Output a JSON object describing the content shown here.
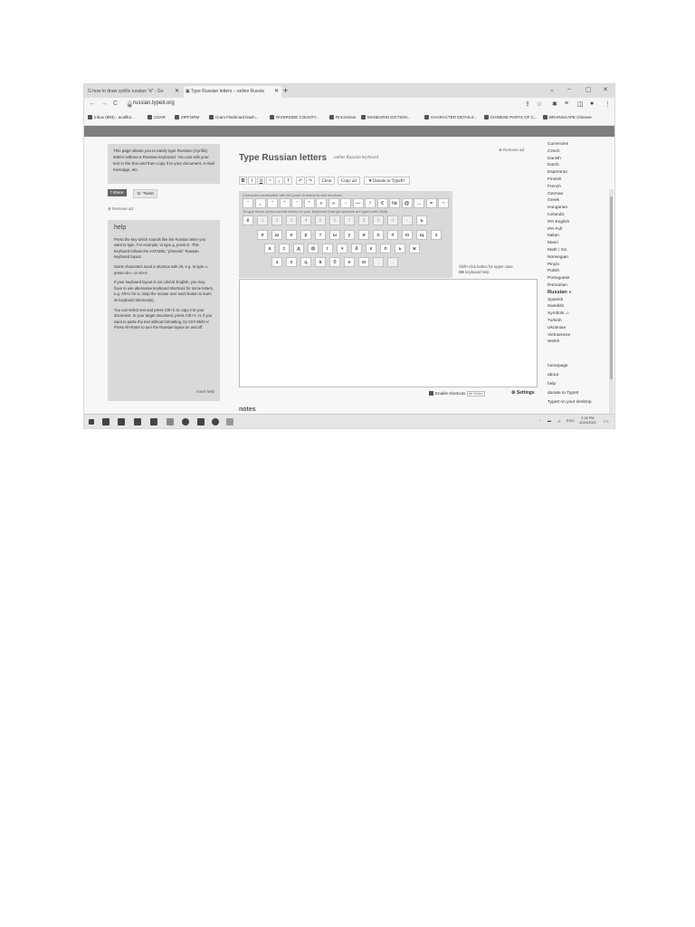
{
  "browser": {
    "tabs": [
      {
        "title": "how to draw cyrillic russian \"d\" - Go"
      },
      {
        "title": "Type Russian letters – online Russia"
      }
    ],
    "url": "russian.typeit.org",
    "bookmarks": [
      "Inbox (883) - acallfor...",
      "CDAR",
      "ZIPFORM",
      "Cram Flashcard Dash...",
      "RIVERSIDE COUNTY...",
      "RnCniView",
      "MANDARIN DICTION...",
      "CHARACTER DETAILS...",
      "CHINESE PARTS OF C...",
      "BRAINSCAPE Chinese"
    ]
  },
  "sidebar": {
    "intro": "This page allows you to easily type Russian (Cyrillic) letters without a Russian keyboard. You can edit your text in the box and then copy it to your document, e-mail message, etc.",
    "share_label": "Share",
    "tweet_label": "Tweet",
    "remove_ad": "Remove ad",
    "help_title": "help",
    "help_p1": "Press the key which sounds like the Russian letter you want to type. For example, to type д, press D. This keyboard follows the AATSEEL \"phonetic\" Russian keyboard layout.",
    "help_p2": "Some characters need a shortcut with Alt, e.g. to type ∞, press Alt+= or Alt+0.",
    "help_p3": "If your keyboard layout is not US/UK English, you may have to use alternative keyboard shortcuts for some letters, e.g. Alt+U for ю. Stop the mouse over each button to learn its keyboard shortcut(s).",
    "help_p4": "You can select text and press Ctrl+C to copy it to your document. In your target document, press Ctrl+V, or, if you want to paste the text without formatting, try Ctrl+Shift+V. Press Alt+Enter to turn the Russian layout on and off.",
    "more_help": "more help"
  },
  "main": {
    "title": "Type Russian letters",
    "subtitle": "online Russian keyboard",
    "remove_ad": "Remove ad",
    "toolbar": {
      "clear": "Clear",
      "copy_all": "Copy all",
      "donate": "♥ Donate to TypeIt!"
    },
    "alt_hint": "Characters accessible with Alt (point at button to see shortcut)",
    "symbols": [
      "'",
      "„",
      "“",
      "”",
      "’",
      "\"",
      "«",
      "»",
      "-",
      "—",
      "!",
      "€",
      "№",
      "@",
      "→",
      "=",
      "~"
    ],
    "type_hint": "To type these, press normal letters on your keyboard (orange symbols are typed with Shift)",
    "row1": [
      "ё",
      "1",
      "2",
      "3",
      "4",
      "5",
      "6",
      "7",
      "8",
      "9",
      "0",
      "-",
      "ъ"
    ],
    "row2": [
      "я",
      "ш",
      "е",
      "р",
      "т",
      "ы",
      "у",
      "и",
      "о",
      "п",
      "ю",
      "щ",
      "э"
    ],
    "row3": [
      "а",
      "с",
      "д",
      "ф",
      "г",
      "ч",
      "й",
      "к",
      "л",
      "ь",
      "ж"
    ],
    "row4": [
      "з",
      "х",
      "ц",
      "в",
      "б",
      "н",
      "м",
      ",",
      "."
    ],
    "shift_note": "Shift+click button for upper case",
    "keyboard_help": "keyboard help",
    "enable_shortcuts": "Enable shortcuts",
    "alt_enter": "Alt+Enter",
    "settings": "Settings",
    "notes": "notes"
  },
  "languages": [
    "Currencies",
    "Czech",
    "Danish",
    "Dutch",
    "Esperanto",
    "Finnish",
    "French",
    "German",
    "Greek",
    "Hungarian",
    "Icelandic",
    "IPA English",
    "IPA Full",
    "Italian",
    "Maori",
    "Math / Sci.",
    "Norwegian",
    "Pinyin",
    "Polish",
    "Portuguese",
    "Romanian",
    "Russian »",
    "Spanish",
    "Swedish",
    "Symbols ☺",
    "Turkish",
    "Ukrainian",
    "Vietnamese",
    "Welsh"
  ],
  "footer_links": [
    "homepage",
    "about",
    "help",
    "donate to TypeIt",
    "TypeIt on your desktop"
  ],
  "taskbar": {
    "time": "2:26 PM",
    "date": "11/20/2022",
    "lang": "ENG"
  }
}
